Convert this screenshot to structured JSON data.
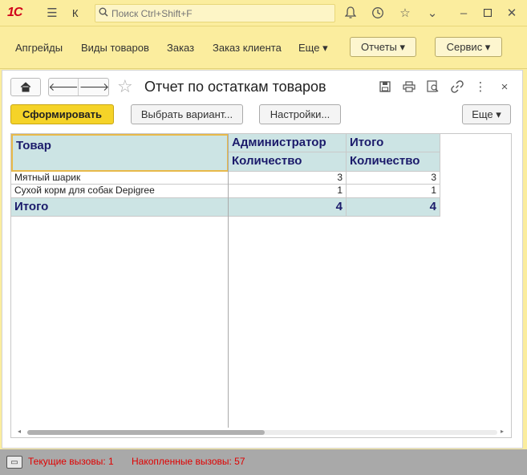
{
  "titlebar": {
    "logo": "1С",
    "app_short": "К",
    "search_placeholder": "Поиск Ctrl+Shift+F"
  },
  "nav": {
    "links": [
      "Апгрейды",
      "Виды товаров",
      "Заказ",
      "Заказ клиента",
      "Еще ▾"
    ],
    "reports_button": "Отчеты ▾",
    "service_button": "Сервис ▾"
  },
  "form": {
    "title": "Отчет по остаткам товаров",
    "generate_button": "Сформировать",
    "choose_variant_button": "Выбрать вариант...",
    "settings_button": "Настройки...",
    "more_button": "Еще ▾"
  },
  "report": {
    "header_item": "Товар",
    "header_group": "Администратор",
    "header_total": "Итого",
    "subheader_qty": "Количество",
    "subheader_qty_total": "Количество",
    "rows": [
      {
        "item": "Мятный шарик",
        "qty": "3",
        "total": "3"
      },
      {
        "item": "Сухой корм для собак Depigree",
        "qty": "1",
        "total": "1"
      }
    ],
    "total_row": {
      "label": "Итого",
      "qty": "4",
      "total": "4"
    }
  },
  "statusbar": {
    "current_calls": "Текущие вызовы: 1",
    "accumulated_calls": "Накопленные вызовы: 57"
  },
  "colors": {
    "accent": "#fbed9e",
    "primary_button": "#f5d328",
    "report_header": "#cce4e4",
    "status_text": "#e00000"
  }
}
